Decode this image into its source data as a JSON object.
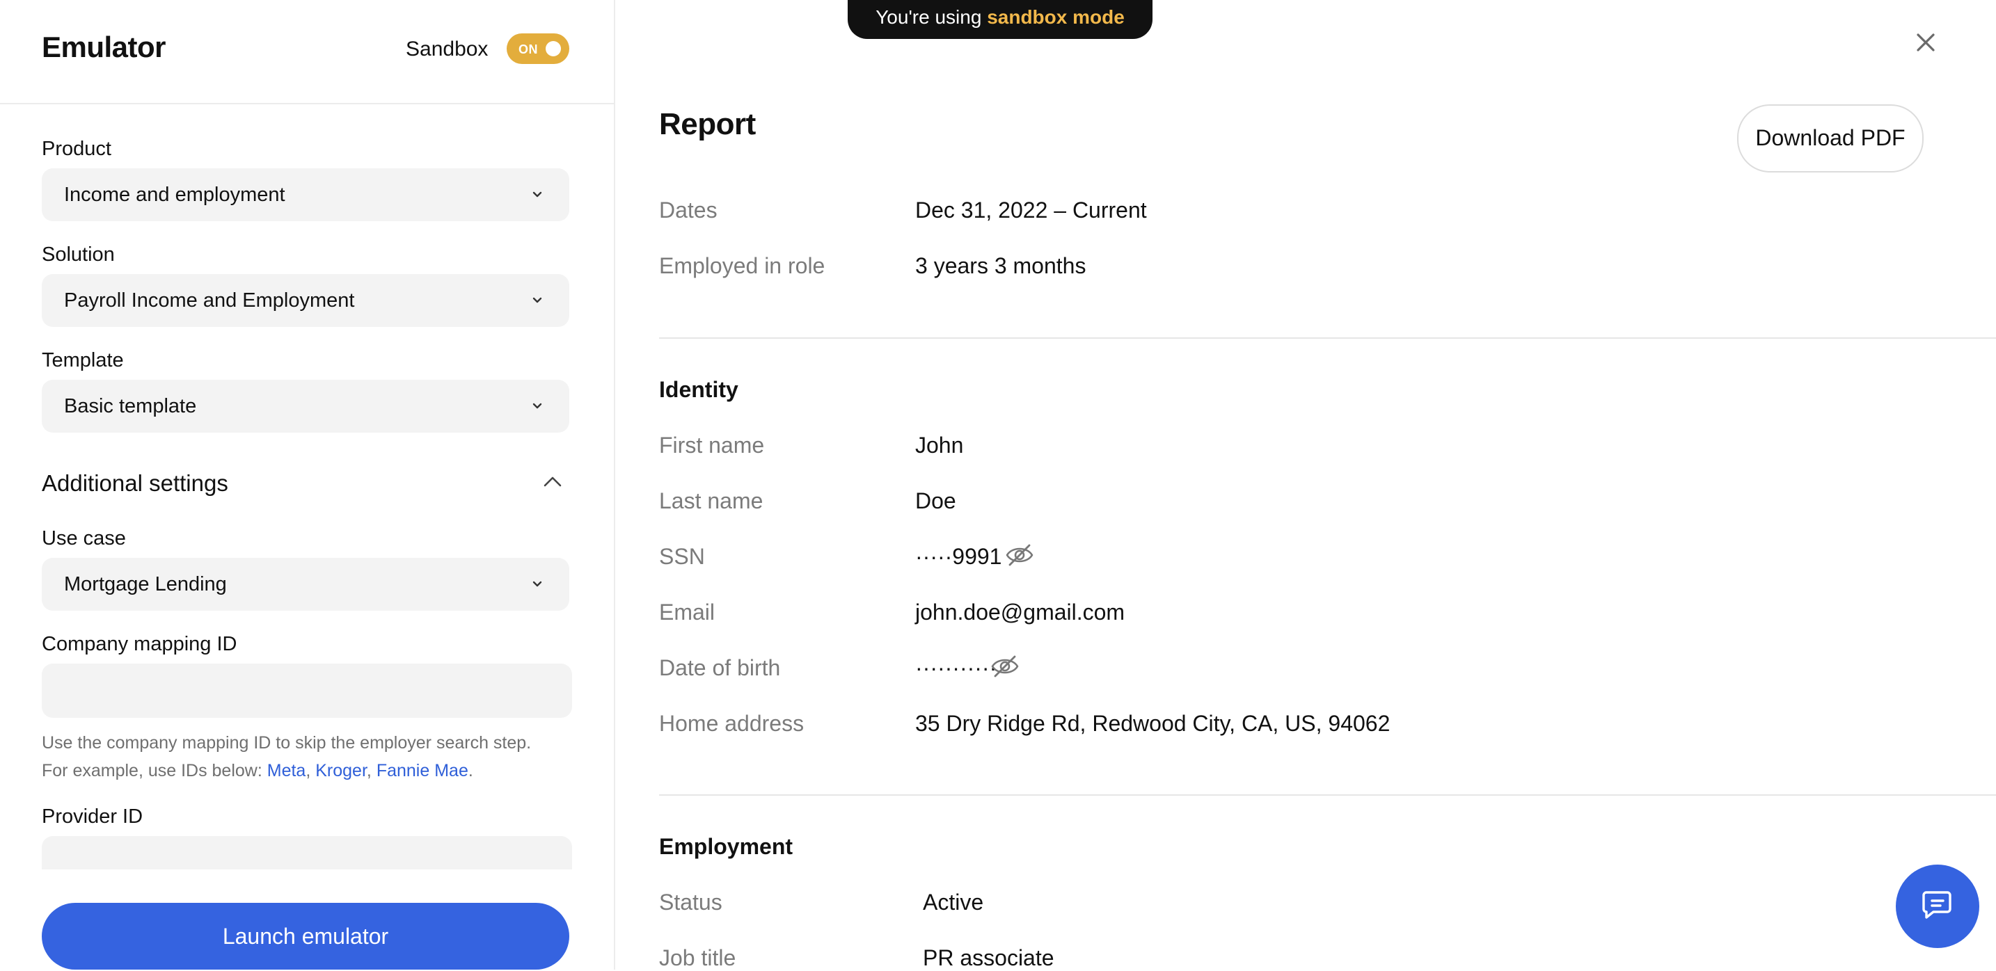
{
  "left": {
    "title": "Emulator",
    "sandbox_label": "Sandbox",
    "toggle_text": "ON",
    "product": {
      "label": "Product",
      "value": "Income and employment"
    },
    "solution": {
      "label": "Solution",
      "value": "Payroll Income and Employment"
    },
    "template": {
      "label": "Template",
      "value": "Basic template"
    },
    "additional_settings": "Additional settings",
    "use_case": {
      "label": "Use case",
      "value": "Mortgage Lending"
    },
    "company_mapping": {
      "label": "Company mapping ID",
      "value": "",
      "help_line1": "Use the company mapping ID to skip the employer search step.",
      "help_line2_prefix": "For example, use IDs below: ",
      "links": [
        "Meta",
        "Kroger",
        "Fannie Mae"
      ],
      "sep": ", ",
      "end": "."
    },
    "provider": {
      "label": "Provider ID",
      "value": ""
    },
    "launch_label": "Launch emulator"
  },
  "banner": {
    "prefix": "You're using ",
    "accent": "sandbox mode"
  },
  "report": {
    "title": "Report",
    "download_label": "Download PDF",
    "summary": [
      {
        "label": "Dates",
        "value": "Dec 31, 2022 – Current"
      },
      {
        "label": "Employed in role",
        "value": "3 years 3 months"
      }
    ],
    "identity": {
      "title": "Identity",
      "rows": [
        {
          "label": "First name",
          "value": "John"
        },
        {
          "label": "Last name",
          "value": "Doe"
        },
        {
          "label": "SSN",
          "value": "·····9991"
        },
        {
          "label": "Email",
          "value": "john.doe@gmail.com"
        },
        {
          "label": "Date of birth",
          "value": "···········"
        },
        {
          "label": "Home address",
          "value": "35 Dry Ridge Rd, Redwood City, CA, US, 94062"
        }
      ]
    },
    "employment": {
      "title": "Employment",
      "rows": [
        {
          "label": "Status",
          "value": "Active"
        },
        {
          "label": "Job title",
          "value": "PR associate"
        }
      ]
    }
  },
  "colors": {
    "accent": "#3563e0",
    "sandbox": "#e3ad3c",
    "banner_accent": "#f2b84b"
  }
}
